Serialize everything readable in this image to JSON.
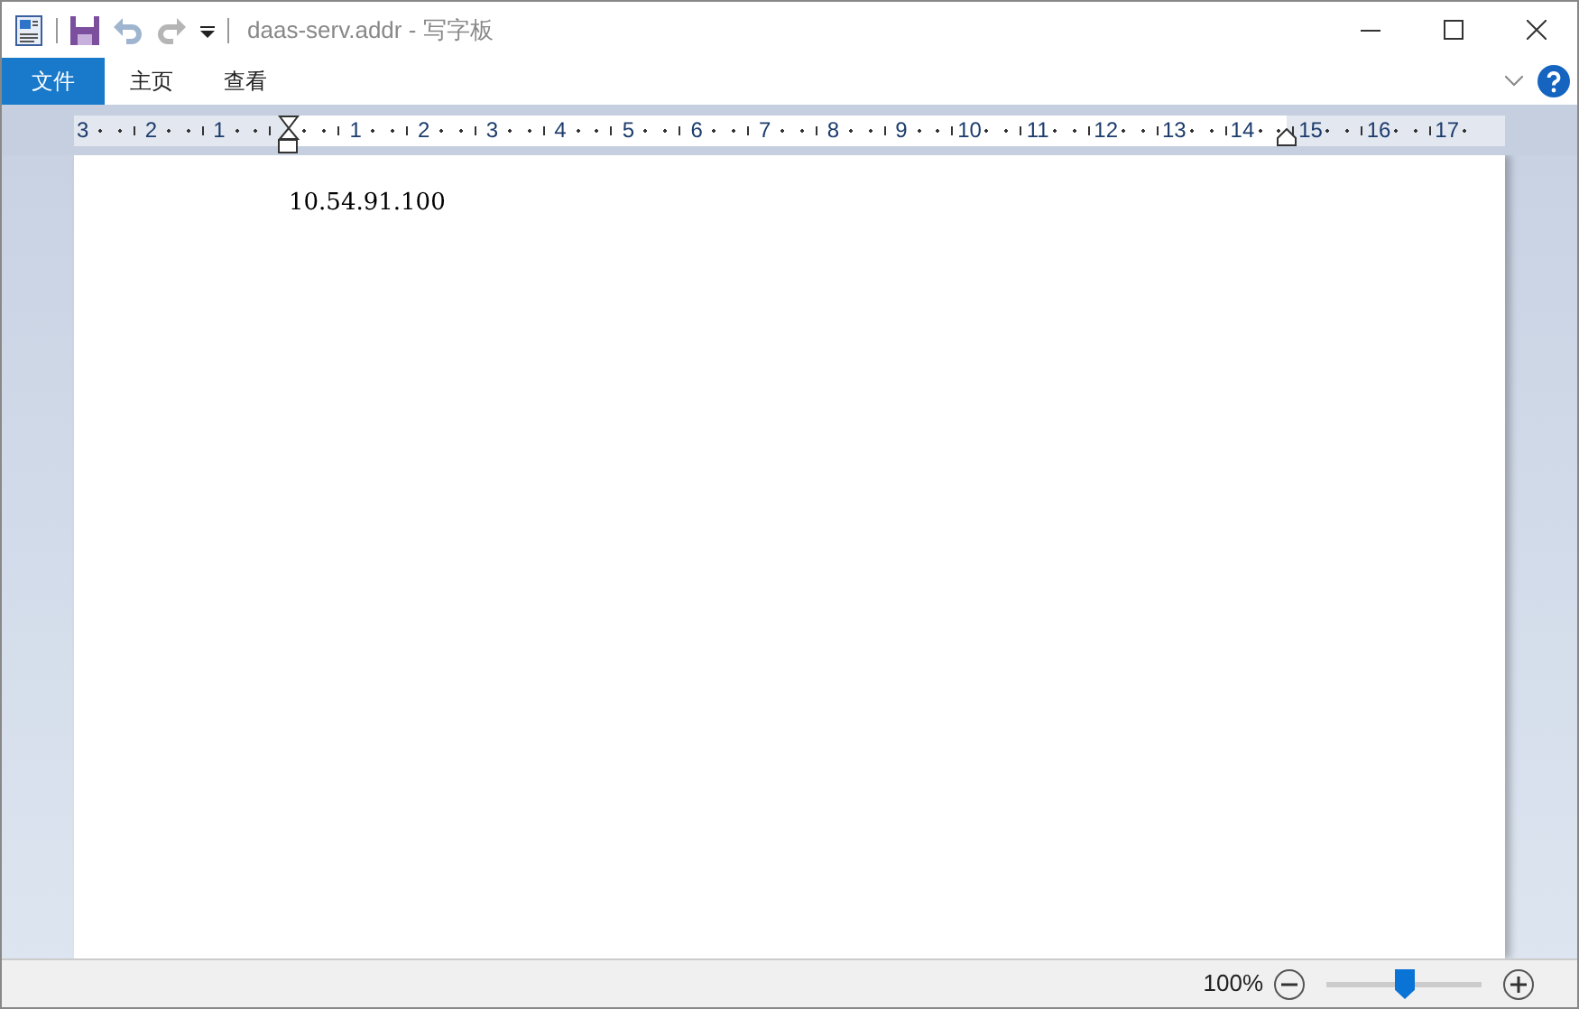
{
  "window": {
    "title": "daas-serv.addr - 写字板"
  },
  "tabs": [
    {
      "label": "文件",
      "selected": true
    },
    {
      "label": "主页",
      "selected": false
    },
    {
      "label": "查看",
      "selected": false
    }
  ],
  "ruler": {
    "left_labels": [
      "3",
      "2",
      "1"
    ],
    "labels": [
      "1",
      "2",
      "3",
      "4",
      "5",
      "6",
      "7",
      "8",
      "9",
      "10",
      "11",
      "12",
      "13",
      "14",
      "15",
      "16",
      "17"
    ]
  },
  "document": {
    "text": "10.54.91.100"
  },
  "status_bar": {
    "zoom": "100%",
    "level": 0.5
  }
}
